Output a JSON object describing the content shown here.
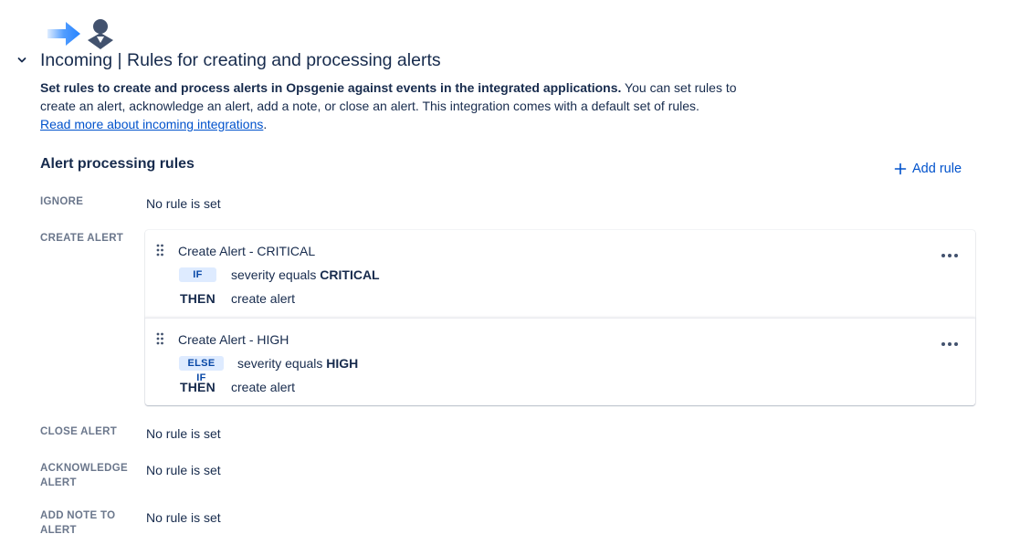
{
  "header": {
    "title": "Incoming | Rules for creating and processing alerts",
    "description_bold": "Set rules to create and process alerts in Opsgenie against events in the integrated applications.",
    "description_rest": " You can set rules to create an alert, acknowledge an alert, add a note, or close an alert. This integration comes with a default set of rules.",
    "read_more_link": "Read more about incoming integrations",
    "read_more_suffix": "."
  },
  "section": {
    "title": "Alert processing rules",
    "add_rule_label": "Add rule"
  },
  "rows": {
    "ignore": {
      "label": "IGNORE",
      "value": "No rule is set"
    },
    "create_alert": {
      "label": "CREATE ALERT"
    },
    "close_alert": {
      "label": "CLOSE ALERT",
      "value": "No rule is set"
    },
    "acknowledge_alert": {
      "label": "ACKNOWLEDGE ALERT",
      "value": "No rule is set"
    },
    "add_note": {
      "label": "ADD NOTE TO ALERT",
      "value": "No rule is set"
    }
  },
  "rules": [
    {
      "name": "Create Alert - CRITICAL",
      "condition_keyword": "IF",
      "condition_text": "severity equals ",
      "condition_value": "CRITICAL",
      "then_label": "THEN",
      "then_action": "create alert"
    },
    {
      "name": "Create Alert - HIGH",
      "condition_keyword": "ELSE IF",
      "condition_text": "severity equals ",
      "condition_value": "HIGH",
      "then_label": "THEN",
      "then_action": "create alert"
    }
  ],
  "colors": {
    "text_primary": "#172b4d",
    "text_subtle": "#6b778c",
    "link": "#0052cc",
    "badge_bg": "#deebff",
    "badge_text": "#0747a6",
    "logo_blue": "#2684ff",
    "logo_dark": "#42526e"
  },
  "icons": {
    "logo": "integration-logo-icon",
    "collapse": "chevron-down-icon",
    "add": "plus-icon",
    "drag": "drag-handle-icon",
    "more": "more-horizontal-icon"
  }
}
